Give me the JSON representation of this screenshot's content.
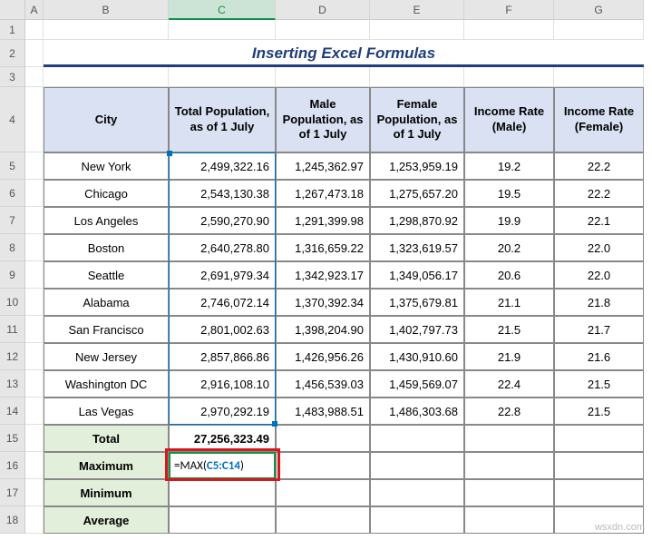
{
  "columns": [
    "A",
    "B",
    "C",
    "D",
    "E",
    "F",
    "G"
  ],
  "col_widths": {
    "corner": 28,
    "A": 20,
    "B": 138,
    "C": 118,
    "D": 104,
    "E": 104,
    "F": 99,
    "G": 99
  },
  "title": "Inserting Excel Formulas",
  "headers": {
    "city": "City",
    "total_pop": "Total Population, as of 1 July",
    "male_pop": "Male Population, as of 1 July",
    "female_pop": "Female Population, as of 1 July",
    "rate_male": "Income Rate (Male)",
    "rate_female": "Income Rate (Female)"
  },
  "rows": [
    {
      "city": "New York",
      "total": "2,499,322.16",
      "male": "1,245,362.97",
      "female": "1,253,959.19",
      "rm": "19.2",
      "rf": "22.2"
    },
    {
      "city": "Chicago",
      "total": "2,543,130.38",
      "male": "1,267,473.18",
      "female": "1,275,657.20",
      "rm": "19.5",
      "rf": "22.2"
    },
    {
      "city": "Los Angeles",
      "total": "2,590,270.90",
      "male": "1,291,399.98",
      "female": "1,298,870.92",
      "rm": "19.9",
      "rf": "22.1"
    },
    {
      "city": "Boston",
      "total": "2,640,278.80",
      "male": "1,316,659.22",
      "female": "1,323,619.57",
      "rm": "20.2",
      "rf": "22.0"
    },
    {
      "city": "Seattle",
      "total": "2,691,979.34",
      "male": "1,342,923.17",
      "female": "1,349,056.17",
      "rm": "20.6",
      "rf": "22.0"
    },
    {
      "city": "Alabama",
      "total": "2,746,072.14",
      "male": "1,370,392.34",
      "female": "1,375,679.81",
      "rm": "21.1",
      "rf": "21.8"
    },
    {
      "city": "San Francisco",
      "total": "2,801,002.63",
      "male": "1,398,204.90",
      "female": "1,402,797.73",
      "rm": "21.5",
      "rf": "21.7"
    },
    {
      "city": "New Jersey",
      "total": "2,857,866.86",
      "male": "1,426,956.26",
      "female": "1,430,910.60",
      "rm": "21.9",
      "rf": "21.6"
    },
    {
      "city": "Washington DC",
      "total": "2,916,108.10",
      "male": "1,456,539.03",
      "female": "1,459,569.07",
      "rm": "22.4",
      "rf": "21.5"
    },
    {
      "city": "Las Vegas",
      "total": "2,970,292.19",
      "male": "1,483,988.51",
      "female": "1,486,303.68",
      "rm": "22.8",
      "rf": "21.5"
    }
  ],
  "summary": {
    "total_label": "Total",
    "total_value": "27,256,323.49",
    "max_label": "Maximum",
    "min_label": "Minimum",
    "avg_label": "Average"
  },
  "formula": {
    "text_eq": "=",
    "fn": "MAX(",
    "ref": "C5:C14",
    "close": ")"
  },
  "active_col": "C",
  "watermark": "wsxdn.com",
  "chart_data": {
    "type": "table",
    "title": "Inserting Excel Formulas",
    "columns": [
      "City",
      "Total Population, as of 1 July",
      "Male Population, as of 1 July",
      "Female Population, as of 1 July",
      "Income Rate (Male)",
      "Income Rate (Female)"
    ],
    "data": [
      [
        "New York",
        2499322.16,
        1245362.97,
        1253959.19,
        19.2,
        22.2
      ],
      [
        "Chicago",
        2543130.38,
        1267473.18,
        1275657.2,
        19.5,
        22.2
      ],
      [
        "Los Angeles",
        2590270.9,
        1291399.98,
        1298870.92,
        19.9,
        22.1
      ],
      [
        "Boston",
        2640278.8,
        1316659.22,
        1323619.57,
        20.2,
        22.0
      ],
      [
        "Seattle",
        2691979.34,
        1342923.17,
        1349056.17,
        20.6,
        22.0
      ],
      [
        "Alabama",
        2746072.14,
        1370392.34,
        1375679.81,
        21.1,
        21.8
      ],
      [
        "San Francisco",
        2801002.63,
        1398204.9,
        1402797.73,
        21.5,
        21.7
      ],
      [
        "New Jersey",
        2857866.86,
        1426956.26,
        1430910.6,
        21.9,
        21.6
      ],
      [
        "Washington DC",
        2916108.1,
        1456539.03,
        1459569.07,
        22.4,
        21.5
      ],
      [
        "Las Vegas",
        2970292.19,
        1483988.51,
        1486303.68,
        22.8,
        21.5
      ]
    ],
    "summary": {
      "Total_C": 27256323.49,
      "formula_entered": "=MAX(C5:C14)"
    }
  }
}
